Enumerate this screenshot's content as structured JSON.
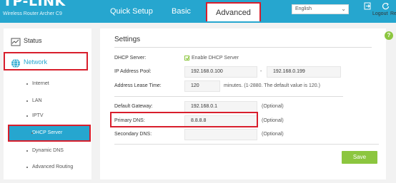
{
  "header": {
    "logo": "TP-LINK",
    "model": "Wireless Router Archer C9",
    "tabs": [
      "Quick Setup",
      "Basic",
      "Advanced"
    ],
    "language": "English",
    "logout_label": "Logout",
    "reboot_label": "Reboot"
  },
  "sidebar": {
    "items": [
      {
        "label": "Status",
        "icon": "status-icon"
      },
      {
        "label": "Network",
        "icon": "globe-icon"
      },
      {
        "label": "Internet"
      },
      {
        "label": "LAN"
      },
      {
        "label": "IPTV"
      },
      {
        "label": "DHCP Server"
      },
      {
        "label": "Dynamic DNS"
      },
      {
        "label": "Advanced Routing"
      }
    ]
  },
  "settings": {
    "title": "Settings",
    "dhcp_server_label": "DHCP Server:",
    "dhcp_enable_label": "Enable DHCP Server",
    "ip_pool_label": "IP Address Pool:",
    "ip_pool_start": "192.168.0.100",
    "ip_pool_sep": "-",
    "ip_pool_end": "192.168.0.199",
    "lease_label": "Address Lease Time:",
    "lease_value": "120",
    "lease_note": "minutes. (1-2880. The default value is 120.)",
    "gateway_label": "Default Gateway:",
    "gateway_value": "192.168.0.1",
    "primary_dns_label": "Primary DNS:",
    "primary_dns_value": "8.8.8.8",
    "secondary_dns_label": "Secondary DNS:",
    "secondary_dns_value": "",
    "optional": "(Optional)",
    "save_label": "Save"
  },
  "colors": {
    "header": "#26a6cf",
    "highlight": "#d81e2c",
    "accent_green": "#8cc63f",
    "selected_item": "#26a6cf"
  }
}
